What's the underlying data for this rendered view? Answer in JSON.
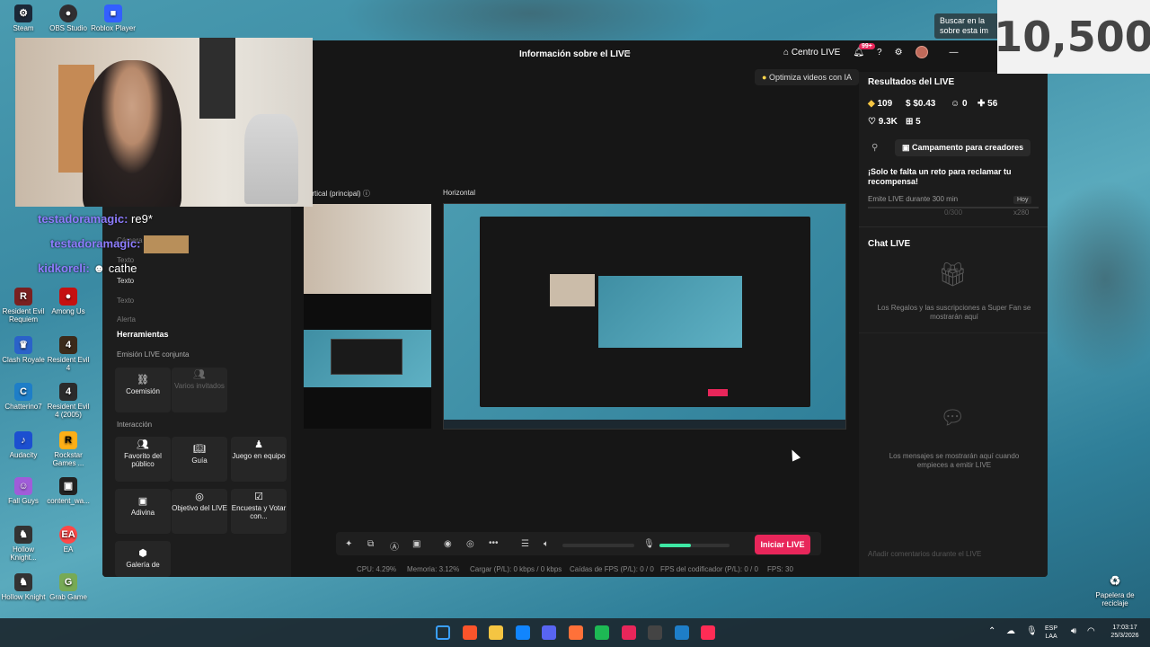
{
  "desktop": {
    "icons_top": [
      {
        "label": "Steam",
        "icon": "steam-icon",
        "color": "#1b2838"
      },
      {
        "label": "OBS Studio",
        "icon": "obs-icon",
        "color": "#302e31"
      },
      {
        "label": "Roblox Player",
        "icon": "roblox-icon",
        "color": "#335fff"
      }
    ],
    "icons_left": [
      {
        "label": "Resident Evil Requiem",
        "icon": "re-requiem-icon",
        "color": "#7a2020"
      },
      {
        "label": "Among Us",
        "icon": "among-us-icon",
        "color": "#c51111"
      },
      {
        "label": "Clash Royale",
        "icon": "clash-royale-icon",
        "color": "#2a62c9"
      },
      {
        "label": "Resident Evil 4",
        "icon": "re4-icon",
        "color": "#3b2a1a"
      },
      {
        "label": "Chatterino7",
        "icon": "chatterino-icon",
        "color": "#1e7ec8"
      },
      {
        "label": "Resident Evil 4 (2005)",
        "icon": "re4-2005-icon",
        "color": "#2b2b2b"
      },
      {
        "label": "Audacity",
        "icon": "audacity-icon",
        "color": "#1c4fd0"
      },
      {
        "label": "Rockstar Games ...",
        "icon": "rockstar-icon",
        "color": "#fcaf17"
      },
      {
        "label": "Fall Guys",
        "icon": "fall-guys-icon",
        "color": "#a05cd9"
      },
      {
        "label": "content_wa...",
        "icon": "content-icon",
        "color": "#222"
      },
      {
        "label": "Hollow Knight...",
        "icon": "hollow-knight-icon",
        "color": "#333"
      },
      {
        "label": "EA",
        "icon": "ea-icon",
        "color": "#ff4747"
      },
      {
        "label": "Hollow Knight",
        "icon": "hollow-knight2-icon",
        "color": "#333"
      },
      {
        "label": "Grab Game",
        "icon": "grab-game-icon",
        "color": "#7a5"
      }
    ],
    "recycle_label": "Papelera de reciclaje"
  },
  "overlay": {
    "counter": "10,500",
    "search_tip": "Buscar en la sobre esta im",
    "chat": [
      {
        "user": "testadoramagic:",
        "msg": "re9*"
      },
      {
        "user": "testadoramagic:",
        "msg": ""
      },
      {
        "user": "kidkoreli:",
        "msg": "cathe"
      }
    ]
  },
  "app": {
    "title": "Información sobre el LIVE",
    "centro_live": "Centro LIVE",
    "notif_badge": "99+",
    "ai_button": "Optimiza videos con IA",
    "preview_vertical_label": "Vertical (principal)",
    "preview_horizontal_label": "Horizontal",
    "layers": [
      "Cámara",
      "Texto",
      "Texto",
      "Texto",
      "Alerta"
    ],
    "tools": {
      "title": "Herramientas",
      "joint_label": "Emisión LIVE conjunta",
      "coemision": "Coemisión",
      "varios": "Varios invitados",
      "interaction_label": "Interacción",
      "favorito": "Favorito del público",
      "guia": "Guía",
      "juego": "Juego en equipo",
      "adivina": "Adivina",
      "objetivo": "Objetivo del LIVE",
      "encuesta": "Encuesta y Votar con...",
      "galeria": "Galería de"
    },
    "results": {
      "title": "Resultados del LIVE",
      "diamonds": "109",
      "money": "$0.43",
      "viewers": "0",
      "followers": "56",
      "likes": "9.3K",
      "gifts": "5",
      "camp_button": "Campamento para creadores",
      "challenge_title": "¡Solo te falta un reto para reclamar tu recompensa!",
      "challenge_desc": "Emite LIVE durante 300 min",
      "challenge_badge": "Hoy",
      "challenge_progress": "0/300",
      "challenge_reward": "x280"
    },
    "chat": {
      "title": "Chat LIVE",
      "gifts_info": "Los Regalos y las suscripciones a Super Fan se mostrarán aquí",
      "messages_info": "Los mensajes se mostrarán aquí cuando empieces a emitir LIVE",
      "input_placeholder": "Añadir comentarios durante el LIVE"
    },
    "start_button": "Iniciar LIVE",
    "status": {
      "cpu": "CPU: 4.29%",
      "memory": "Memoria: 3.12%",
      "load": "Cargar (P/L): 0 kbps / 0 kbps",
      "fps_drops": "Caídas de FPS (P/L): 0 / 0",
      "encoder": "FPS del codificador (P/L): 0 / 0",
      "fps": "FPS: 30"
    },
    "mic_level": 0.45
  },
  "taskbar": {
    "language": "ESP",
    "region": "LAA",
    "time": "17:03:17",
    "date": "25/3/2026",
    "apps": [
      {
        "icon": "windows-start-icon",
        "color": "#3aa0ff"
      },
      {
        "icon": "brave-icon",
        "color": "#fb542b"
      },
      {
        "icon": "file-explorer-icon",
        "color": "#f5c542"
      },
      {
        "icon": "bluesky-icon",
        "color": "#1185fe"
      },
      {
        "icon": "discord-icon",
        "color": "#5865f2"
      },
      {
        "icon": "firefox-icon",
        "color": "#ff7139"
      },
      {
        "icon": "spotify-icon",
        "color": "#1db954"
      },
      {
        "icon": "media-icon",
        "color": "#e8265a"
      },
      {
        "icon": "obs-taskbar-icon",
        "color": "#444"
      },
      {
        "icon": "chatterino-taskbar-icon",
        "color": "#1e7ec8"
      },
      {
        "icon": "tiktok-live-icon",
        "color": "#fe2c55"
      }
    ]
  }
}
